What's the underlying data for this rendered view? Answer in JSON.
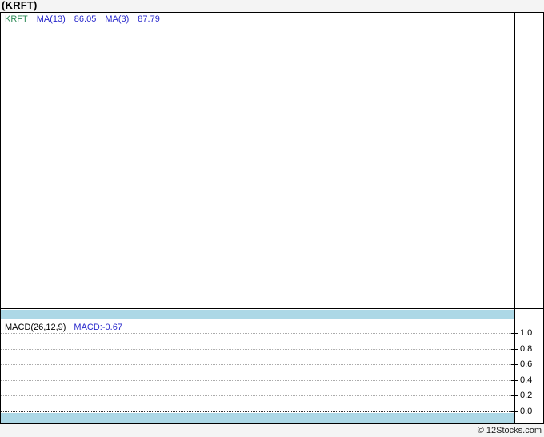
{
  "title": "(KRFT)",
  "price_panel": {
    "legend_symbol": "KRFT",
    "ma13_label": "MA(13)",
    "ma13_value": "86.05",
    "ma3_label": "MA(3)",
    "ma3_value": "87.79"
  },
  "macd_panel": {
    "legend_label": "MACD(26,12,9)",
    "legend_value": "MACD:-0.67",
    "yticks": [
      "1.0",
      "0.8",
      "0.6",
      "0.4",
      "0.2",
      "0.0"
    ]
  },
  "footer": {
    "credit": "© 12Stocks.com"
  },
  "colors": {
    "page_background": "#f4f4f4",
    "panel_background": "#ffffff",
    "border": "#000000",
    "date_strip": "#acd8e6",
    "gridline": "#aaaaaa",
    "zero_gridline": "#333333",
    "legend_symbol_green": "#2e8b57",
    "legend_value_blue": "#2929cc"
  },
  "chart_data": [
    {
      "type": "line",
      "panel": "price",
      "title": "(KRFT)",
      "series": [
        {
          "name": "KRFT",
          "color": "#2e8b57",
          "values": []
        },
        {
          "name": "MA(13)",
          "color": "#2929cc",
          "last_value": 86.05,
          "values": []
        },
        {
          "name": "MA(3)",
          "color": "#2929cc",
          "last_value": 87.79,
          "values": []
        }
      ],
      "legend_position": "top-left",
      "grid": "off",
      "note": "plot area is rendered empty - no price data drawn"
    },
    {
      "type": "line",
      "panel": "macd",
      "title": "MACD(26,12,9)",
      "series": [
        {
          "name": "MACD",
          "last_value": -0.67,
          "values": []
        }
      ],
      "yticks": [
        1.0,
        0.8,
        0.6,
        0.4,
        0.2,
        0.0
      ],
      "ylim": [
        -0.05,
        1.15
      ],
      "grid": "dotted horizontal",
      "legend_position": "top-left",
      "note": "plot area is rendered empty - no MACD curve drawn"
    }
  ]
}
